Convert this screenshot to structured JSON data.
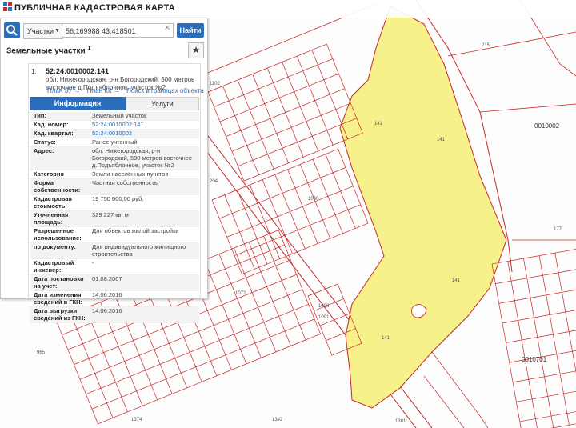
{
  "app": {
    "title": "ПУБЛИЧНАЯ КАДАСТРОВАЯ КАРТА"
  },
  "search": {
    "type_label": "Участки",
    "query": "56,169988 43,418501",
    "find_label": "Найти"
  },
  "results": {
    "section_title": "Земельные участки",
    "count": "1",
    "item_no": "1.",
    "parcel_id": "52:24:0010002:141",
    "address": "обл. Нижегородская, р-н Богородский, 500 метров восточнее д.Подъяблонное, участок №2",
    "links": [
      "План ЗУ →",
      "План КК →",
      "Поиск в границах объекта →"
    ]
  },
  "tabs": {
    "info": "Информация",
    "services": "Услуги"
  },
  "properties": [
    {
      "k": "Тип:",
      "v": "Земельный участок"
    },
    {
      "k": "Кад. номер:",
      "v": "52:24:0010002:141"
    },
    {
      "k": "Кад. квартал:",
      "v": "52:24:0010002"
    },
    {
      "k": "Статус:",
      "v": "Ранее учтенный"
    },
    {
      "k": "Адрес:",
      "v": "обл. Нижегородская, р-н Богородский, 500 метров восточнее д.Подъяблонное, участок №2"
    },
    {
      "k": "Категория земель:",
      "v": "Земли населённых пунктов"
    },
    {
      "k": "Форма собственности:",
      "v": "Частная собственность"
    },
    {
      "k": "Кадастровая стоимость:",
      "v": "19 750 000,00 руб."
    },
    {
      "k": "Уточненная площадь:",
      "v": "329 227 кв. м"
    },
    {
      "k": "Разрешенное использование:",
      "v": "Для объектов жилой застройки"
    },
    {
      "k": "по документу:",
      "v": "Для индивидуального жилищного строительства"
    },
    {
      "k": "Кадастровый инженер:",
      "v": "-"
    },
    {
      "k": "Дата постановки на учет:",
      "v": "01.08.2007"
    },
    {
      "k": "Дата изменения сведений в ГКН:",
      "v": "14.06.2016"
    },
    {
      "k": "Дата выгрузки сведений из ГКН:",
      "v": "14.06.2016"
    }
  ],
  "map": {
    "parcel_label": "141",
    "quarter_labels": [
      "0010002",
      "0010701"
    ],
    "lot_numbers": [
      "215",
      "204",
      "177",
      "965",
      "1102",
      "1040",
      "1072",
      "1090",
      "1091",
      "1374",
      "1342",
      "1381"
    ],
    "colors": {
      "parcel_fill": "#f6f18a",
      "boundary": "#c62828",
      "accent": "#2a6ebb"
    }
  }
}
